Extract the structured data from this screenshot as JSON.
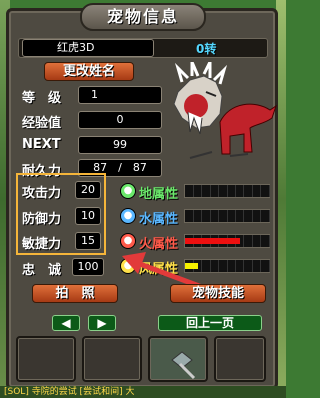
{
  "window": {
    "title": "宠物信息"
  },
  "pet": {
    "name": "红虎3D",
    "rebirth": "0转"
  },
  "buttons": {
    "rename": "更改姓名",
    "photo": "拍　照",
    "skills": "宠物技能",
    "prev_arrow": "◀",
    "next_arrow": "▶",
    "back": "回上一页"
  },
  "stats": [
    {
      "label": "等　级",
      "value": "1"
    },
    {
      "label": "经验值",
      "value": "0"
    },
    {
      "label": "NEXT",
      "value": "99"
    },
    {
      "label": "耐久力",
      "value": "87　/　87"
    }
  ],
  "combat": [
    {
      "label": "攻击力",
      "value": "20"
    },
    {
      "label": "防御力",
      "value": "10"
    },
    {
      "label": "敏捷力",
      "value": "15"
    }
  ],
  "loyalty": {
    "label": "忠　诚",
    "value": "100"
  },
  "attributes": [
    {
      "label": "地属性",
      "icon": "earth-icon",
      "color": "#6be86b",
      "level": 0,
      "bar_color": "#2aa02a"
    },
    {
      "label": "水属性",
      "icon": "water-icon",
      "color": "#5ab7ff",
      "level": 0,
      "bar_color": "#2a70e0"
    },
    {
      "label": "火属性",
      "icon": "fire-icon",
      "color": "#ff5a4a",
      "level": 0.65,
      "bar_color": "#ee1010"
    },
    {
      "label": "风属性",
      "icon": "wind-icon",
      "color": "#ffe04a",
      "level": 0.15,
      "bar_color": "#f6f000"
    }
  ],
  "bottom_text": "[SOL] 寺院的尝试 [尝试和间] 大",
  "colors": {
    "highlight": "#f5b53a",
    "arrow": "#e23a3a"
  }
}
